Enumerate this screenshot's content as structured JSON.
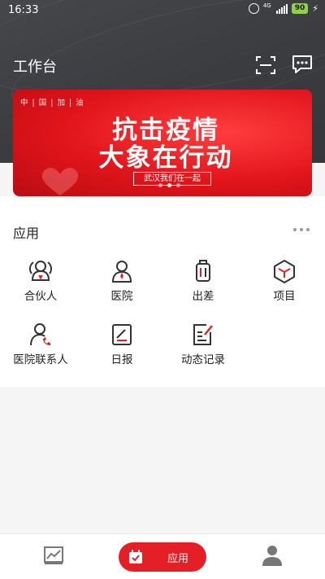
{
  "status_bar": {
    "time": "16:33",
    "network": "4G",
    "battery": "90"
  },
  "header": {
    "title": "工作台",
    "scan_icon": "scan-icon",
    "message_icon": "chat-icon"
  },
  "banner": {
    "tag": "中 | 国 | 加 | 油",
    "title_line1": "抗击疫情",
    "title_line2": "大象在行动",
    "tagline": "武汉我们在一起",
    "page_count": 3,
    "active_page": 2
  },
  "apps_section": {
    "title": "应用",
    "items": [
      {
        "label": "合伙人",
        "icon": "partner-icon"
      },
      {
        "label": "医院",
        "icon": "doctor-icon"
      },
      {
        "label": "出差",
        "icon": "luggage-icon"
      },
      {
        "label": "项目",
        "icon": "cube-icon"
      },
      {
        "label": "医院联系人",
        "icon": "contact-phone-icon"
      },
      {
        "label": "日报",
        "icon": "daily-report-icon"
      },
      {
        "label": "动态记录",
        "icon": "record-edit-icon"
      }
    ]
  },
  "bottom_nav": {
    "tabs": [
      {
        "label": "",
        "icon": "chart-icon"
      },
      {
        "label": "应用",
        "icon": "calendar-check-icon",
        "active": true
      },
      {
        "label": "",
        "icon": "profile-icon"
      }
    ]
  },
  "colors": {
    "accent": "#e51f26",
    "header_bg": "#3d3f43"
  }
}
